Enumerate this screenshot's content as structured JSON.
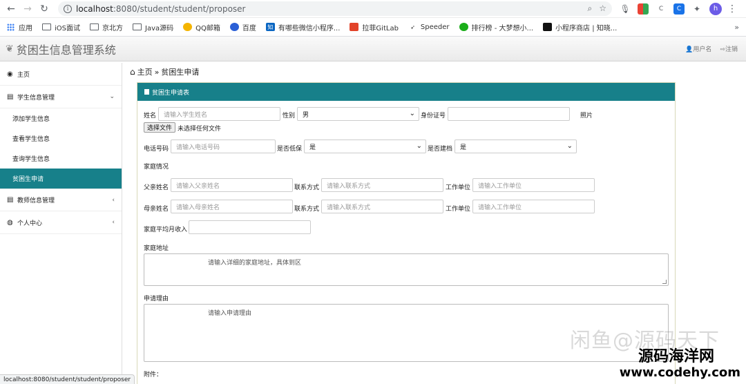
{
  "browser": {
    "url_host": "localhost",
    "url_path": ":8080/student/student/proposer",
    "profile_initial": "h",
    "bookmarks": [
      "应用",
      "iOS面试",
      "京北方",
      "Java源码",
      "QQ邮箱",
      "百度",
      "有哪些微信小程序...",
      "拉菲GitLab",
      "Speeder",
      "排行榜 - 大梦想小...",
      "小程序商店 | 知晓..."
    ],
    "status_url": "localhost:8080/student/student/proposer"
  },
  "app": {
    "title": "贫困生信息管理系统",
    "user_label": "用户名",
    "logout_label": "注销"
  },
  "sidebar": {
    "home": "主页",
    "student_mgmt": "学生信息管理",
    "sub": [
      "添加学生信息",
      "查看学生信息",
      "查询学生信息",
      "贫困生申请"
    ],
    "teacher_mgmt": "教师信息管理",
    "personal": "个人中心"
  },
  "breadcrumb": {
    "home": "主页",
    "sep": "»",
    "current": "贫困生申请"
  },
  "form": {
    "panel_title": "贫困生申请表",
    "name_label": "姓名",
    "name_ph": "请输入学生姓名",
    "gender_label": "性别",
    "gender_value": "男",
    "idcard_label": "身份证号",
    "photo_label": "照片",
    "file_btn": "选择文件",
    "file_none": "未选择任何文件",
    "phone_label": "电话号码",
    "phone_ph": "请输入电话号码",
    "dibao_label": "是否低保",
    "dibao_value": "是",
    "jianka_label": "是否建档",
    "jianka_value": "是",
    "family_label": "家庭情况",
    "father_label": "父亲姓名",
    "father_ph": "请输入父亲姓名",
    "contact_label": "联系方式",
    "contact_ph": "请输入联系方式",
    "work_label": "工作单位",
    "work_ph": "请输入工作单位",
    "mother_label": "母亲姓名",
    "mother_ph": "请输入母亲姓名",
    "income_label": "家庭平均月收入",
    "address_label": "家庭地址",
    "address_ph": "请输入详细的家庭地址，具体到区",
    "reason_label": "申请理由",
    "reason_ph": "请输入申请理由",
    "attach_label": "附件："
  },
  "watermark": {
    "line1": "闲鱼@源码天下",
    "line2": "源码海洋网",
    "line3": "www.codehy.com"
  }
}
